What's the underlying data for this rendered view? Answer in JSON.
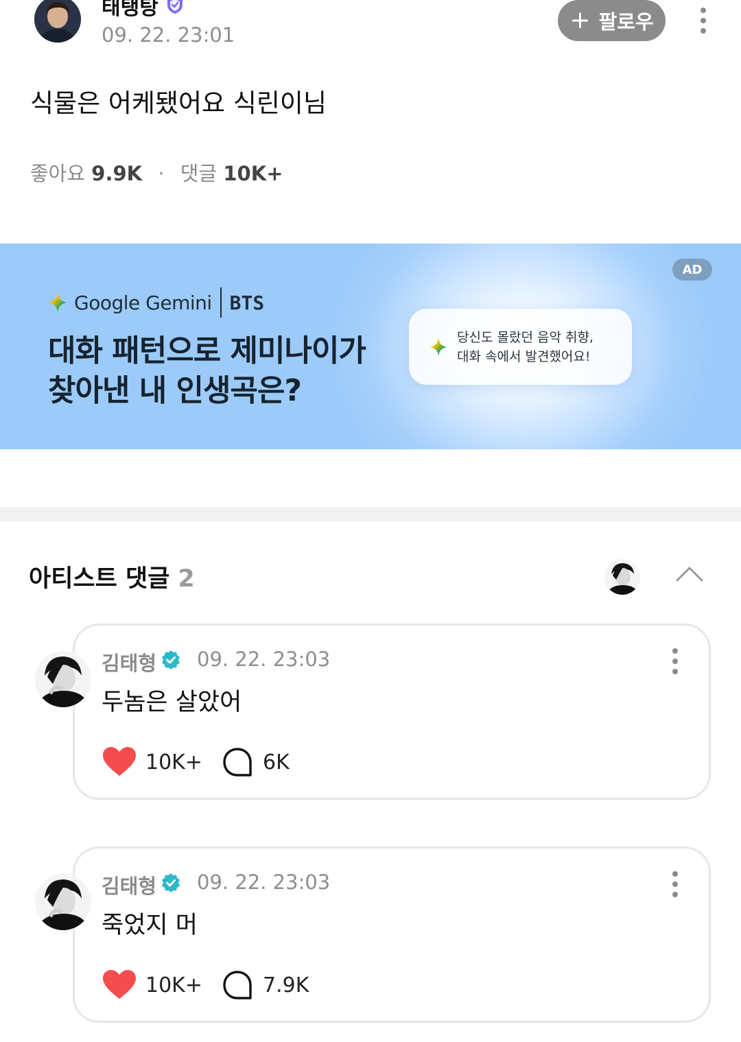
{
  "post": {
    "author": "태탱탕",
    "time": "09. 22. 23:01",
    "follow_label": "팔로우",
    "body": "식물은 어케됐어요 식린이님",
    "likes_label": "좋아요",
    "likes_count": "9.9K",
    "comments_label": "댓글",
    "comments_count": "10K+"
  },
  "ad": {
    "brand": "Google Gemini",
    "partner": "BTS",
    "headline_line1": "대화 패턴으로 제미나이가",
    "headline_line2": "찾아낸 내 인생곡은?",
    "bubble_line1": "당신도 몰랐던 음악 취향,",
    "bubble_line2": "대화 속에서 발견했어요!",
    "tag": "AD"
  },
  "artist_comments": {
    "title": "아티스트 댓글",
    "count": "2",
    "items": [
      {
        "name": "김태형",
        "time": "09. 22. 23:03",
        "text": "두놈은 살았어",
        "likes": "10K+",
        "replies": "6K"
      },
      {
        "name": "김태형",
        "time": "09. 22. 23:03",
        "text": "죽었지 머",
        "likes": "10K+",
        "replies": "7.9K"
      }
    ]
  },
  "colors": {
    "heart": "#f44d4d",
    "verified_teal": "#2bb8c9",
    "badge_purple": "#7b6cf6",
    "follow_bg": "#8b8b8b"
  },
  "icons": [
    "verified-badge-icon",
    "plus-icon",
    "more-icon",
    "gemini-spark-icon",
    "chevron-up-icon",
    "heart-icon",
    "comment-bubble-icon"
  ]
}
